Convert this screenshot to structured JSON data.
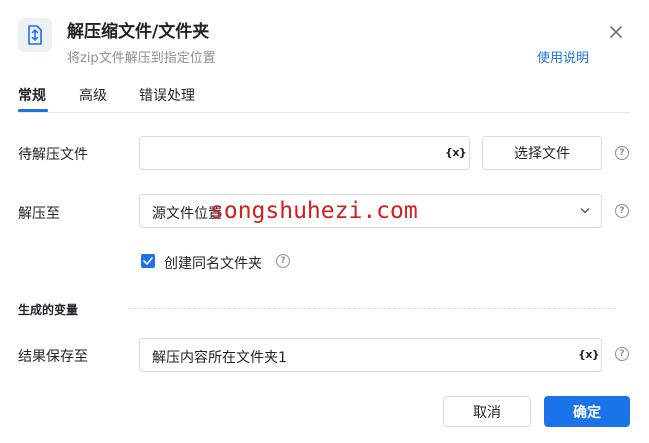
{
  "header": {
    "title": "解压缩文件/文件夹",
    "subtitle": "将zip文件解压到指定位置",
    "help_link": "使用说明"
  },
  "tabs": [
    {
      "label": "常规",
      "active": true
    },
    {
      "label": "高级",
      "active": false
    },
    {
      "label": "错误处理",
      "active": false
    }
  ],
  "form": {
    "source_file": {
      "label": "待解压文件",
      "value": "",
      "var_icon": "{x}",
      "select_button": "选择文件"
    },
    "extract_to": {
      "label": "解压至",
      "value": "源文件位置"
    },
    "create_folder": {
      "label": "创建同名文件夹",
      "checked": true
    },
    "output_section": {
      "title": "生成的变量"
    },
    "result_save": {
      "label": "结果保存至",
      "value": "解压内容所在文件夹1",
      "var_icon": "{x}"
    }
  },
  "footer": {
    "cancel": "取消",
    "confirm": "确定"
  },
  "watermark": "songshuhezi.com",
  "colors": {
    "accent": "#1a73e8",
    "watermark": "#d21f1f",
    "text": "#1f2329",
    "muted": "#8a8f99"
  }
}
